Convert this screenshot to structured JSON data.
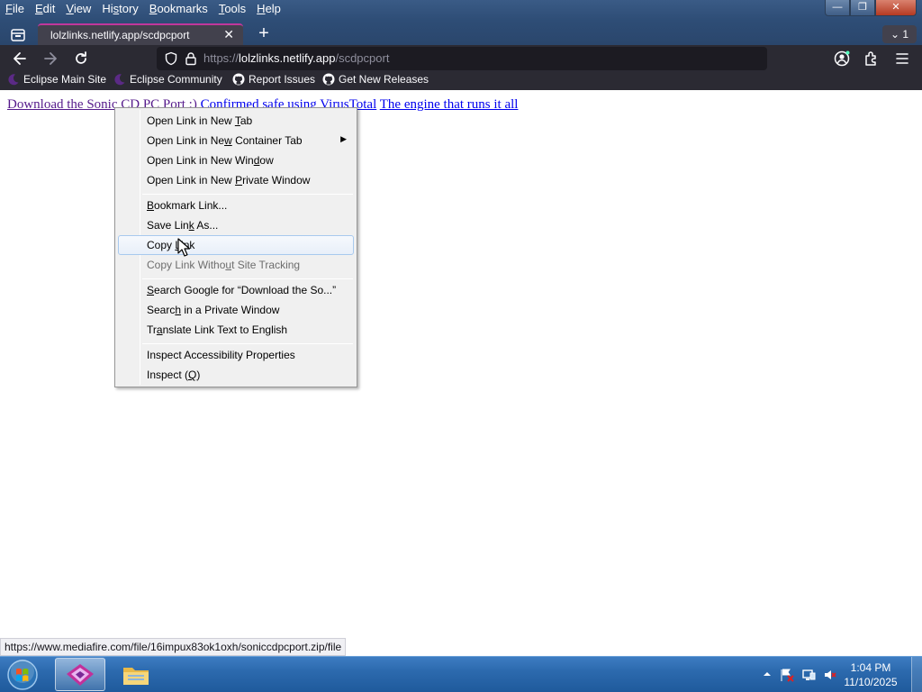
{
  "menubar": {
    "items": [
      {
        "pre": "",
        "u": "F",
        "post": "ile"
      },
      {
        "pre": "",
        "u": "E",
        "post": "dit"
      },
      {
        "pre": "",
        "u": "V",
        "post": "iew"
      },
      {
        "pre": "Hi",
        "u": "s",
        "post": "tory"
      },
      {
        "pre": "",
        "u": "B",
        "post": "ookmarks"
      },
      {
        "pre": "",
        "u": "T",
        "post": "ools"
      },
      {
        "pre": "",
        "u": "H",
        "post": "elp"
      }
    ]
  },
  "window": {
    "minimize": "—",
    "maximize": "❐",
    "close": "✕"
  },
  "tab": {
    "title": "lolzlinks.netlify.app/scdpcport",
    "close": "✕",
    "new_tab": "+",
    "overflow_count": "1"
  },
  "urlbar": {
    "scheme": "https://",
    "host": "lolzlinks.netlify.app",
    "path": "/scdpcport"
  },
  "bookmarks": [
    {
      "label": "Eclipse Main Site",
      "icon": "moon-icon"
    },
    {
      "label": "Eclipse Community",
      "icon": "moon-icon"
    },
    {
      "label": "Report Issues",
      "icon": "github-icon"
    },
    {
      "label": "Get New Releases",
      "icon": "github-icon"
    }
  ],
  "page": {
    "link1": "Download the Sonic CD PC Port :)",
    "link2": "Confirmed safe using VirusTotal",
    "link3": "The engine that runs it all"
  },
  "context_menu": {
    "items": [
      {
        "pre": "Open Link in New ",
        "u": "T",
        "post": "ab"
      },
      {
        "pre": "Open Link in Ne",
        "u": "w",
        "post": " Container Tab"
      },
      {
        "pre": "Open Link in New Win",
        "u": "d",
        "post": "ow"
      },
      {
        "pre": "Open Link in New ",
        "u": "P",
        "post": "rivate Window"
      },
      {
        "pre": "",
        "u": "B",
        "post": "ookmark Link..."
      },
      {
        "pre": "Save Lin",
        "u": "k",
        "post": " As..."
      },
      {
        "pre": "Copy ",
        "u": "L",
        "post": "ink"
      },
      {
        "pre": "Copy Link Witho",
        "u": "u",
        "post": "t Site Tracking"
      },
      {
        "pre": "",
        "u": "S",
        "post": "earch Google for “Download the So...”"
      },
      {
        "pre": "Searc",
        "u": "h",
        "post": " in a Private Window"
      },
      {
        "pre": "Tr",
        "u": "a",
        "post": "nslate Link Text to English"
      },
      {
        "pre": "Inspect Accessibility Properties",
        "u": "",
        "post": ""
      },
      {
        "pre": "Inspect (",
        "u": "Q",
        "post": ")"
      }
    ]
  },
  "status_url": "https://www.mediafire.com/file/16impux83ok1oxh/soniccdpcport.zip/file",
  "taskbar": {
    "time": "1:04 PM",
    "date": "11/10/2025"
  }
}
